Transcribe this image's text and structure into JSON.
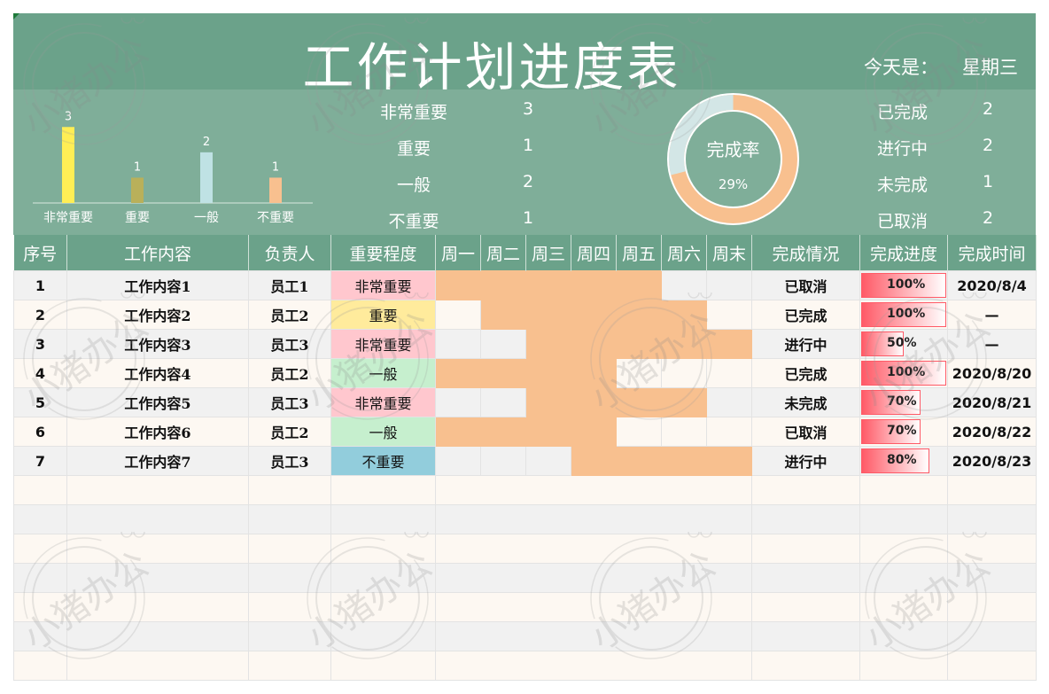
{
  "header": {
    "title": "工作计划进度表",
    "today_label": "今天是：",
    "today_value": "星期三"
  },
  "importance_chart": {
    "type": "bar",
    "categories": [
      "非常重要",
      "重要",
      "一般",
      "不重要"
    ],
    "values": [
      3,
      1,
      2,
      1
    ],
    "colors": [
      "#ffee55",
      "#b9b05a",
      "#bfe2e4",
      "#f8c08f"
    ],
    "ylim": [
      0,
      3.5
    ]
  },
  "importance_stats": [
    {
      "label": "非常重要",
      "value": "3"
    },
    {
      "label": "重要",
      "value": "1"
    },
    {
      "label": "一般",
      "value": "2"
    },
    {
      "label": "不重要",
      "value": "1"
    }
  ],
  "completion": {
    "label": "完成率",
    "value_text": "29%",
    "fraction": 0.29,
    "colors": {
      "done": "#d3e6e6",
      "rest": "#f8c08f"
    }
  },
  "status_stats": [
    {
      "label": "已完成",
      "value": "2"
    },
    {
      "label": "进行中",
      "value": "2"
    },
    {
      "label": "未完成",
      "value": "1"
    },
    {
      "label": "已取消",
      "value": "2"
    }
  ],
  "table": {
    "columns": [
      "序号",
      "工作内容",
      "负责人",
      "重要程度",
      "周一",
      "周二",
      "周三",
      "周四",
      "周五",
      "周六",
      "周末",
      "完成情况",
      "完成进度",
      "完成时间"
    ],
    "rows": [
      {
        "no": "1",
        "task": "工作内容1",
        "owner": "员工1",
        "importance": "非常重要",
        "level": "a",
        "days": [
          1,
          1,
          1,
          1,
          1,
          0,
          0
        ],
        "status": "已取消",
        "progress_text": "100%",
        "progress": 1.0,
        "date": "2020/8/4"
      },
      {
        "no": "2",
        "task": "工作内容2",
        "owner": "员工2",
        "importance": "重要",
        "level": "b",
        "days": [
          0,
          1,
          1,
          1,
          1,
          1,
          0
        ],
        "status": "已完成",
        "progress_text": "100%",
        "progress": 1.0,
        "date": "—"
      },
      {
        "no": "3",
        "task": "工作内容3",
        "owner": "员工3",
        "importance": "非常重要",
        "level": "a",
        "days": [
          0,
          0,
          1,
          1,
          1,
          1,
          1
        ],
        "status": "进行中",
        "progress_text": "50%",
        "progress": 0.5,
        "date": "—"
      },
      {
        "no": "4",
        "task": "工作内容4",
        "owner": "员工2",
        "importance": "一般",
        "level": "c",
        "days": [
          1,
          1,
          1,
          1,
          0,
          0,
          0
        ],
        "status": "已完成",
        "progress_text": "100%",
        "progress": 1.0,
        "date": "2020/8/20"
      },
      {
        "no": "5",
        "task": "工作内容5",
        "owner": "员工3",
        "importance": "非常重要",
        "level": "a",
        "days": [
          0,
          0,
          1,
          1,
          1,
          1,
          0
        ],
        "status": "未完成",
        "progress_text": "70%",
        "progress": 0.7,
        "date": "2020/8/21"
      },
      {
        "no": "6",
        "task": "工作内容6",
        "owner": "员工2",
        "importance": "一般",
        "level": "c",
        "days": [
          1,
          1,
          1,
          1,
          0,
          0,
          0
        ],
        "status": "已取消",
        "progress_text": "70%",
        "progress": 0.7,
        "date": "2020/8/22"
      },
      {
        "no": "7",
        "task": "工作内容7",
        "owner": "员工3",
        "importance": "不重要",
        "level": "d",
        "days": [
          0,
          0,
          0,
          1,
          1,
          1,
          1
        ],
        "status": "进行中",
        "progress_text": "80%",
        "progress": 0.8,
        "date": "2020/8/23"
      }
    ],
    "empty_rows": 7
  },
  "watermark": "小猪办公"
}
